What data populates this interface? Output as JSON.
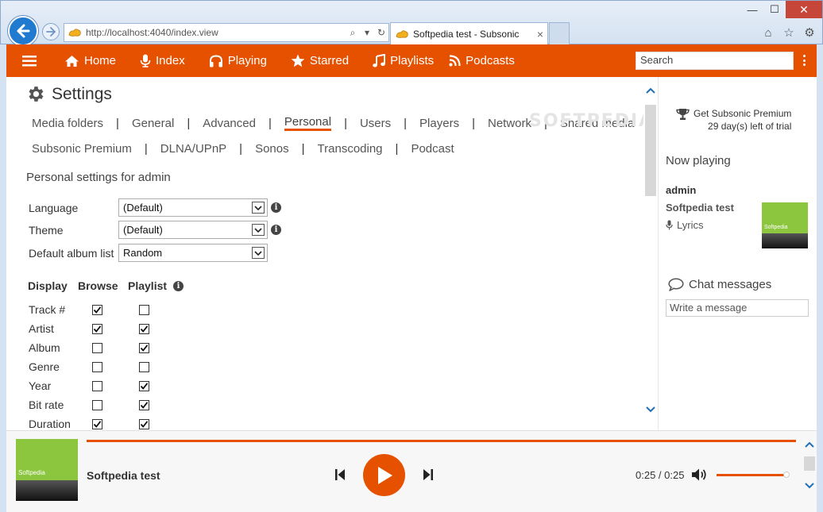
{
  "browser": {
    "url": "http://localhost:4040/index.view",
    "tab_title": "Softpedia test - Subsonic",
    "tab_close": "×",
    "win_min": "—",
    "win_max": "☐",
    "win_close": "✕"
  },
  "nav": {
    "items": [
      {
        "label": "Home",
        "icon": "home-icon"
      },
      {
        "label": "Index",
        "icon": "microphone-icon"
      },
      {
        "label": "Playing",
        "icon": "headphones-icon"
      },
      {
        "label": "Starred",
        "icon": "star-icon"
      },
      {
        "label": "Playlists",
        "icon": "music-icon"
      },
      {
        "label": "Podcasts",
        "icon": "rss-icon"
      }
    ],
    "search_placeholder": "Search",
    "accent": "#e65100"
  },
  "settings": {
    "title": "Settings",
    "tabs_row1": [
      "Media folders",
      "General",
      "Advanced",
      "Personal",
      "Users",
      "Players",
      "Network",
      "Shared media"
    ],
    "tabs_row2": [
      "Subsonic Premium",
      "DLNA/UPnP",
      "Sonos",
      "Transcoding",
      "Podcast"
    ],
    "active_tab": "Personal",
    "subtitle": "Personal settings for admin",
    "language_label": "Language",
    "language_value": "(Default)",
    "theme_label": "Theme",
    "theme_value": "(Default)",
    "album_list_label": "Default album list",
    "album_list_value": "Random",
    "display_header": "Display",
    "browse_header": "Browse",
    "playlist_header": "Playlist",
    "columns": [
      {
        "label": "Track #",
        "browse": true,
        "playlist": false
      },
      {
        "label": "Artist",
        "browse": true,
        "playlist": true
      },
      {
        "label": "Album",
        "browse": false,
        "playlist": true
      },
      {
        "label": "Genre",
        "browse": false,
        "playlist": false
      },
      {
        "label": "Year",
        "browse": false,
        "playlist": true
      },
      {
        "label": "Bit rate",
        "browse": false,
        "playlist": true
      },
      {
        "label": "Duration",
        "browse": true,
        "playlist": true
      }
    ]
  },
  "right_panel": {
    "premium_line1": "Get Subsonic Premium",
    "premium_line2": "29 day(s) left of trial",
    "now_playing_title": "Now playing",
    "user": "admin",
    "song": "Softpedia test",
    "lyrics": "Lyrics",
    "cover_text": "Softpedia",
    "chat_title": "Chat messages",
    "chat_placeholder": "Write a message"
  },
  "player": {
    "song": "Softpedia test",
    "time": "0:25 / 0:25",
    "cover_text": "Softpedia",
    "progress_fraction": 1.0,
    "volume_fraction": 0.95
  },
  "watermark": "SOFTPEDIA"
}
